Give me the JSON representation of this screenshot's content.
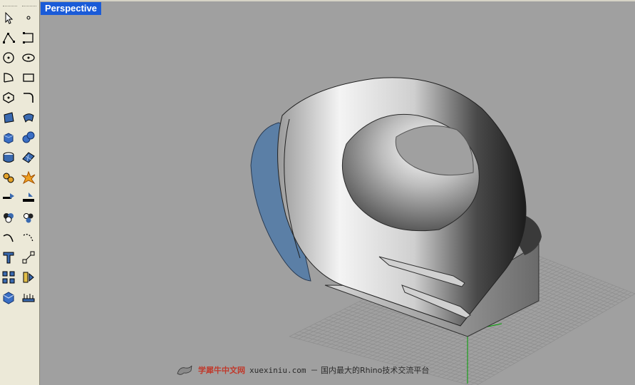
{
  "viewport": {
    "title": "Perspective",
    "background_color": "#a0a0a0",
    "title_bg_color": "#1a5bd8"
  },
  "toolbar": {
    "left_column": [
      "select-arrow-icon",
      "polyline-icon",
      "circle-icon",
      "arc-icon",
      "polygon-icon",
      "surface-point-icon",
      "box-icon",
      "cylinder-icon",
      "solid-tools-icon",
      "boolean-icon",
      "union-icon",
      "curve-fillet-icon",
      "text-icon",
      "array-icon",
      "render-box-icon"
    ],
    "right_column": [
      "point-icon",
      "curve-rectangle-icon",
      "ellipse-icon",
      "rectangle-icon",
      "fillet-curve-icon",
      "patch-icon",
      "sphere-icon",
      "surface-plane-icon",
      "explode-icon",
      "split-icon",
      "boolean-split-icon",
      "chamfer-curve-icon",
      "scale-icon",
      "mirror-icon",
      "dimension-icon"
    ]
  },
  "watermark": {
    "brand": "学犀牛中文网",
    "site": "xuexiniu.com",
    "tagline": "－ 国内最大的Rhino技术交流平台"
  },
  "colors": {
    "toolbar_bg": "#ece9d8",
    "grid_line": "#8e8e8e",
    "model_light": "#e8e8e8",
    "model_dark": "#202020",
    "accent_blue": "#5b7fa6"
  }
}
